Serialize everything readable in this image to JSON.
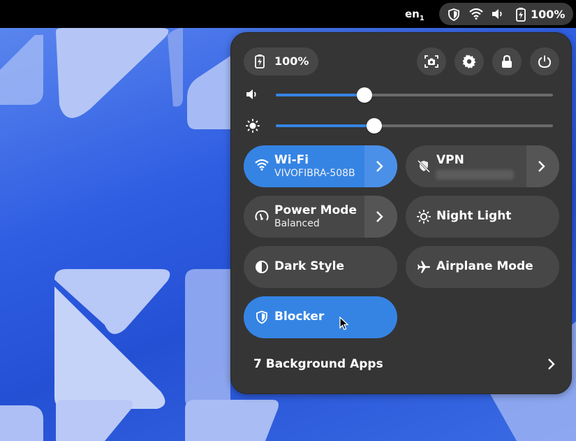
{
  "topbar": {
    "keyboard_layout": "en",
    "keyboard_layout_index": "1",
    "battery_percent": "100%",
    "icons": [
      "shield-icon",
      "wifi-icon",
      "volume-icon",
      "battery-icon"
    ]
  },
  "quick_settings": {
    "battery_label": "100%",
    "buttons": [
      "screenshot-icon",
      "settings-icon",
      "lock-icon",
      "power-icon"
    ],
    "volume_level": 0.32,
    "brightness_level": 0.355,
    "tiles": {
      "wifi": {
        "title": "Wi-Fi",
        "subtitle": "VIVOFIBRA-508B",
        "active": true
      },
      "vpn": {
        "title": "VPN",
        "active": false
      },
      "power_mode": {
        "title": "Power Mode",
        "subtitle": "Balanced",
        "active": false
      },
      "night_light": {
        "title": "Night Light",
        "active": false
      },
      "dark_style": {
        "title": "Dark Style",
        "active": false
      },
      "airplane_mode": {
        "title": "Airplane Mode",
        "active": false
      },
      "blocker": {
        "title": "Blocker",
        "active": true
      }
    },
    "background_apps": "7 Background Apps"
  },
  "colors": {
    "accent": "#3584e4",
    "panel": "#353535",
    "tile": "#474747",
    "topbar": "#000000"
  }
}
